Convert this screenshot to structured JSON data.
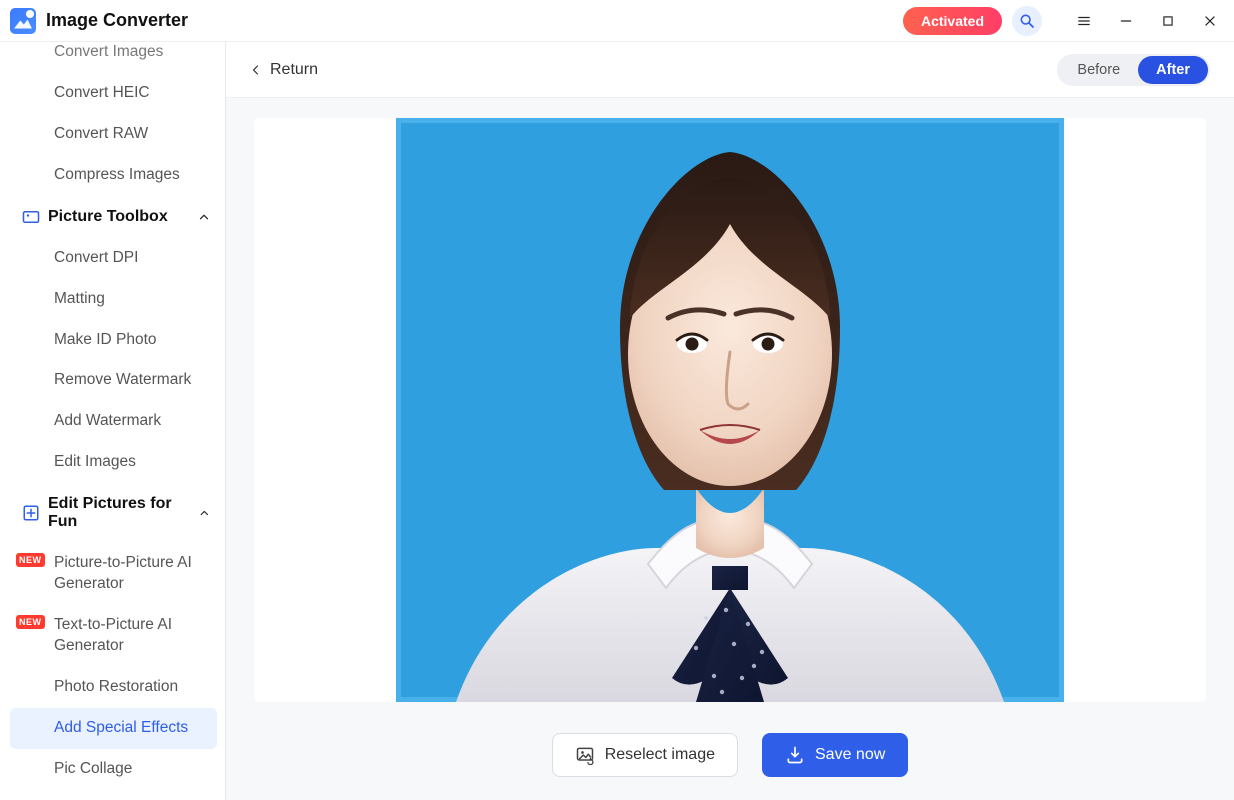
{
  "app": {
    "title": "Image Converter",
    "activated_label": "Activated"
  },
  "sidebar": {
    "top_items": [
      "Convert Images",
      "Convert HEIC",
      "Convert RAW",
      "Compress Images"
    ],
    "toolbox_header": "Picture Toolbox",
    "toolbox_items": [
      "Convert DPI",
      "Matting",
      "Make ID Photo",
      "Remove Watermark",
      "Add Watermark",
      "Edit Images"
    ],
    "fun_header": "Edit Pictures for Fun",
    "fun_items": [
      {
        "label": "Picture-to-Picture AI Generator",
        "new": true
      },
      {
        "label": "Text-to-Picture AI Generator",
        "new": true
      },
      {
        "label": "Photo Restoration",
        "new": false
      },
      {
        "label": "Add Special Effects",
        "new": false,
        "active": true
      },
      {
        "label": "Pic Collage",
        "new": false
      }
    ],
    "new_badge": "NEW"
  },
  "main": {
    "return_label": "Return",
    "before_label": "Before",
    "after_label": "After",
    "reselect_label": "Reselect image",
    "save_label": "Save now",
    "image_alt": "Stylized portrait of a woman in a white collared shirt with a dark bow on a blue background"
  },
  "colors": {
    "accent": "#2952e3",
    "sidebar_active_bg": "#eaf1ff",
    "activated_grad_a": "#ff614f",
    "activated_grad_b": "#ff3e66",
    "canvas_bg": "#2f9fe0"
  }
}
